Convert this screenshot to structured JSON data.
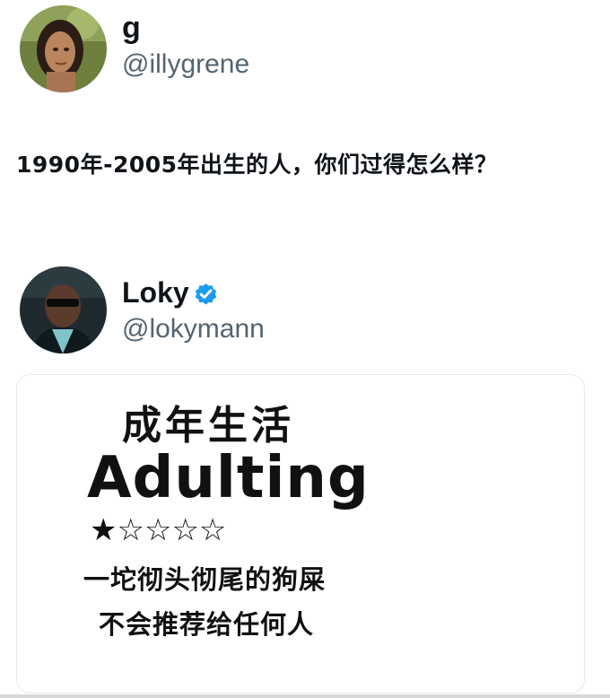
{
  "tweet1": {
    "display_name": "g",
    "handle": "@illygrene",
    "text": "1990年-2005年出生的人，你们过得怎么样？"
  },
  "tweet2": {
    "display_name": "Loky",
    "handle": "@lokymann",
    "verified_color": "#1d9bf0",
    "card": {
      "title_cn": "成年生活",
      "title_en": "Adulting",
      "rating": {
        "filled": 1,
        "total": 5,
        "stars_text": "★☆☆☆☆"
      },
      "line1": "一坨彻头彻尾的狗屎",
      "line2": "不会推荐给任何人"
    }
  }
}
